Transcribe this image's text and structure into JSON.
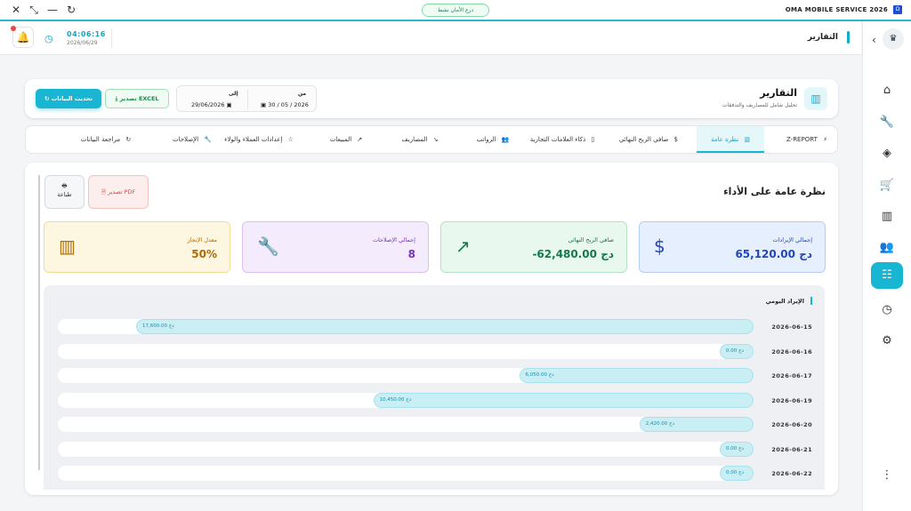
{
  "titlebar": {
    "app_name": "OMA MOBILE SERVICE 2026",
    "logo_glyph": "Ω",
    "safe_mode_label": "درع الأمان نشط",
    "close_glyph": "✕",
    "restore_glyph": "⤡",
    "minimize_glyph": "—",
    "reload_glyph": "↻"
  },
  "topbar": {
    "time": "04:06:16",
    "date": "2026/06/29",
    "page_title": "التقارير",
    "bell_glyph": "🔔",
    "clock_glyph": "◷"
  },
  "sidebar": {
    "collapse_glyph": "‹",
    "logo_glyph": "♛",
    "items": [
      {
        "name": "home-icon",
        "glyph": "⌂"
      },
      {
        "name": "wrench-icon",
        "glyph": "🔧"
      },
      {
        "name": "box-icon",
        "glyph": "◈"
      },
      {
        "name": "cart-icon",
        "glyph": "🛒"
      },
      {
        "name": "bar-chart-icon",
        "glyph": "▥"
      },
      {
        "name": "users-icon",
        "glyph": "👥"
      },
      {
        "name": "reports-icon",
        "glyph": "☷"
      },
      {
        "name": "history-icon",
        "glyph": "◷"
      },
      {
        "name": "settings-icon",
        "glyph": "⚙"
      },
      {
        "name": "more-icon",
        "glyph": "⋮"
      }
    ]
  },
  "header": {
    "title": "التقارير",
    "subtitle": "تحليل شامل للمصاريف والتدفقات",
    "icon_glyph": "▥",
    "from_label": "من",
    "from_date": "30 / 05 / 2026",
    "to_label": "إلى",
    "to_date": "29/06/2026",
    "excel_label": "تصدير EXCEL",
    "refresh_label": "تحديث البيانات"
  },
  "tabs": [
    {
      "label": "Z-REPORT",
      "icon": "⚡"
    },
    {
      "label": "نظرة عامة",
      "icon": "▥"
    },
    {
      "label": "صافي الربح النهائي",
      "icon": "$"
    },
    {
      "label": "ذكاء العلامات التجارية",
      "icon": "▯"
    },
    {
      "label": "الرواتب",
      "icon": "👥"
    },
    {
      "label": "المصاريف",
      "icon": "↘"
    },
    {
      "label": "المبيعات",
      "icon": "↗"
    },
    {
      "label": "إعدادات العملاء والولاء",
      "icon": "☆"
    },
    {
      "label": "الإصلاحات",
      "icon": "🔧"
    },
    {
      "label": "مراجعة البيانات",
      "icon": "↻"
    }
  ],
  "overview": {
    "title": "نظرة عامة على الأداء",
    "pdf_label": "تصدير PDF",
    "print_label": "طباعة",
    "print_glyph": "🖶"
  },
  "stats": [
    {
      "label": "إجمالي الإيرادات",
      "value": "65,120.00 دج",
      "icon": "$",
      "bg": "#e6effd",
      "border": "#b8cdf6",
      "color": "#2146b8"
    },
    {
      "label": "صافي الربح النهائي",
      "value": "-62,480.00 دج",
      "icon": "↗",
      "bg": "#e8f8ee",
      "border": "#b3e4c7",
      "color": "#13794a"
    },
    {
      "label": "إجمالي الإصلاحات",
      "value": "8",
      "icon": "🔧",
      "bg": "#f4ebfd",
      "border": "#d9c1f3",
      "color": "#7a2fbf"
    },
    {
      "label": "معدل الإنجاز",
      "value": "50%",
      "icon": "▥",
      "bg": "#fdf6e0",
      "border": "#f1dc97",
      "color": "#b16b00"
    }
  ],
  "colors": {
    "accent": "#18b6d2",
    "green": "#1b8f4d",
    "red": "#d84a4a"
  },
  "chart_data": {
    "type": "bar",
    "title": "الإيراد اليومي",
    "categories": [
      "2026-06-15",
      "2026-06-16",
      "2026-06-17",
      "2026-06-19",
      "2026-06-20",
      "2026-06-21",
      "2026-06-22"
    ],
    "values": [
      17600,
      0,
      6050,
      10450,
      2420,
      0,
      0
    ],
    "value_labels": [
      "17,600.00 دج",
      "0.00 دج",
      "6,050.00 دج",
      "10,450.00 دج",
      "2,420.00 دج",
      "0.00 دج",
      "0.00 دج"
    ],
    "xlim": [
      0,
      17600
    ],
    "orientation": "horizontal"
  }
}
